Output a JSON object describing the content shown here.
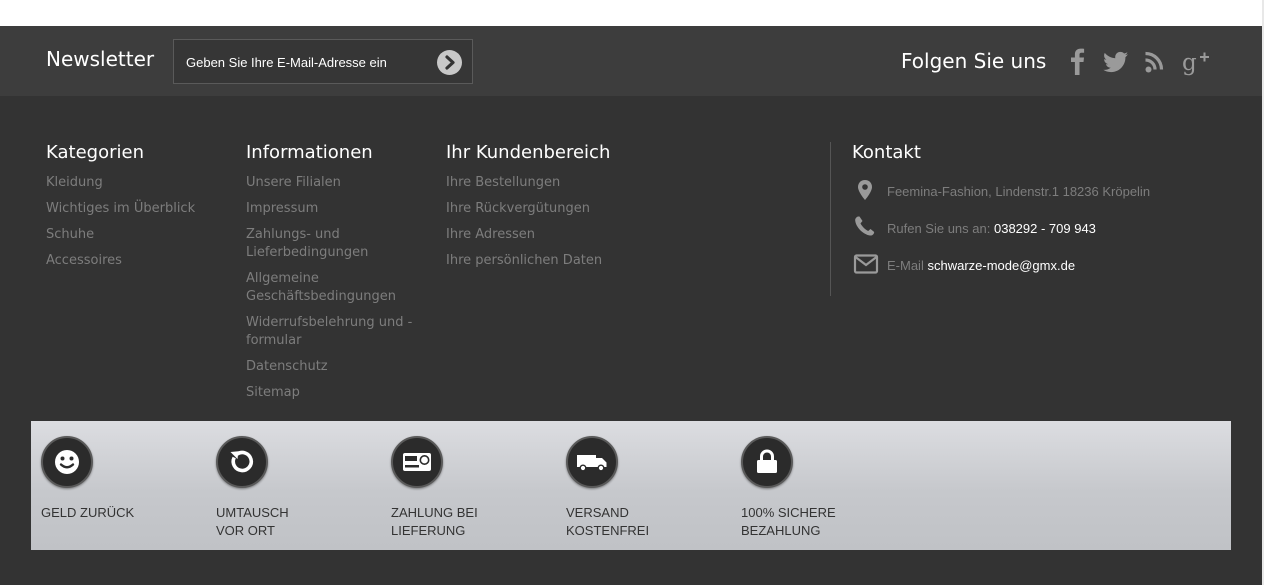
{
  "newsletter": {
    "title": "Newsletter",
    "placeholder": "Geben Sie Ihre E-Mail-Adresse ein"
  },
  "follow": {
    "title": "Folgen Sie uns",
    "icons": [
      "facebook-icon",
      "twitter-icon",
      "rss-icon",
      "google-plus-icon"
    ]
  },
  "categories": {
    "title": "Kategorien",
    "items": [
      "Kleidung",
      "Wichtiges im Überblick",
      "Schuhe",
      "Accessoires"
    ]
  },
  "information": {
    "title": "Informationen",
    "items": [
      "Unsere Filialen",
      "Impressum",
      "Zahlungs- und Lieferbedingungen",
      "Allgemeine Geschäftsbedingungen",
      "Widerrufsbelehrung und -formular",
      "Datenschutz",
      "Sitemap"
    ]
  },
  "customer": {
    "title": "Ihr Kundenbereich",
    "items": [
      "Ihre Bestellungen",
      "Ihre Rückvergütungen",
      "Ihre Adressen",
      "Ihre persönlichen Daten"
    ]
  },
  "contact": {
    "title": "Kontakt",
    "address": "Feemina-Fashion, Lindenstr.1 18236 Kröpelin",
    "phone_label": "Rufen Sie uns an:",
    "phone": "038292 - 709 943",
    "email_label": "E-Mail",
    "email": "schwarze-mode@gmx.de"
  },
  "badges": [
    {
      "icon": "smiley-icon",
      "line1": "GELD ZURÜCK",
      "line2": ""
    },
    {
      "icon": "refresh-icon",
      "line1": "UMTAUSCH",
      "line2": "VOR ORT"
    },
    {
      "icon": "payment-card-icon",
      "line1": "ZAHLUNG BEI",
      "line2": "LIEFERUNG"
    },
    {
      "icon": "truck-icon",
      "line1": "VERSAND",
      "line2": "KOSTENFREI"
    },
    {
      "icon": "lock-icon",
      "line1": "100% SICHERE",
      "line2": "BEZAHLUNG"
    }
  ],
  "colors": {
    "background": "#333333",
    "newsletter_bar": "#3d3d3d",
    "link": "#7d7d7d",
    "heading": "#ffffff",
    "badge_bar": "#c8cacd"
  }
}
